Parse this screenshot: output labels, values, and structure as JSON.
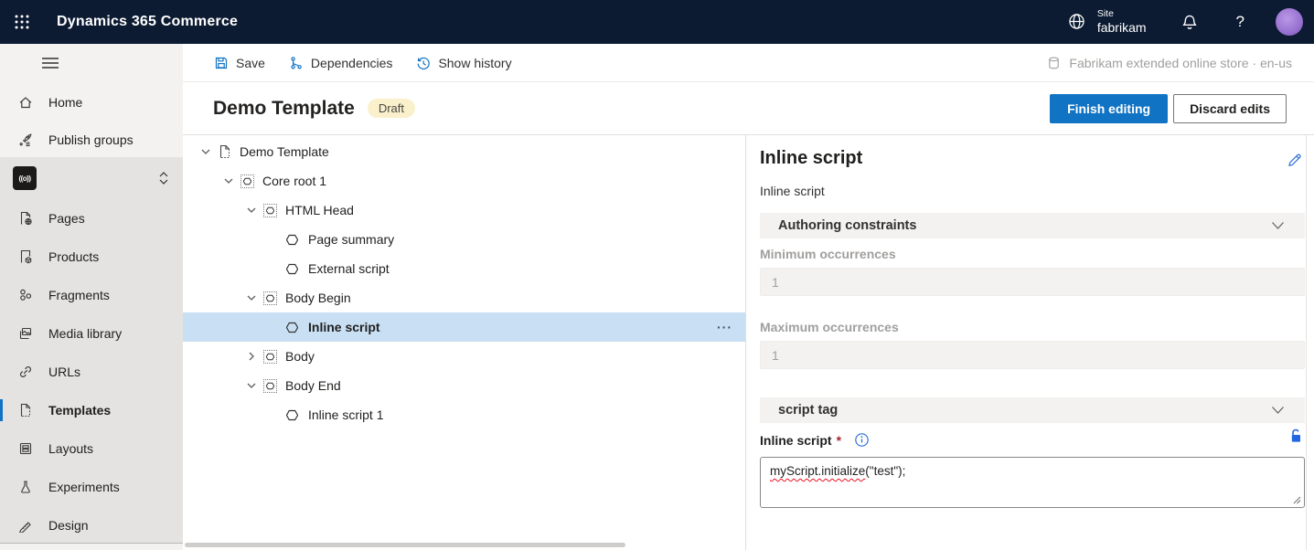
{
  "topbar": {
    "app_title": "Dynamics 365 Commerce",
    "site_label": "Site",
    "site_name": "fabrikam",
    "help_glyph": "?"
  },
  "toolbar": {
    "save_label": "Save",
    "dependencies_label": "Dependencies",
    "show_history_label": "Show history",
    "environment_label": "Fabrikam extended online store · en-us"
  },
  "sidebar": {
    "top_items": [
      {
        "label": "Home"
      },
      {
        "label": "Publish groups"
      }
    ],
    "broadcast_glyph": "((o))",
    "items": [
      {
        "label": "Pages"
      },
      {
        "label": "Products"
      },
      {
        "label": "Fragments"
      },
      {
        "label": "Media library"
      },
      {
        "label": "URLs"
      },
      {
        "label": "Templates",
        "selected": true
      },
      {
        "label": "Layouts"
      },
      {
        "label": "Experiments"
      },
      {
        "label": "Design"
      }
    ]
  },
  "header": {
    "title": "Demo Template",
    "status_badge": "Draft",
    "finish_button": "Finish editing",
    "discard_button": "Discard edits"
  },
  "tree": {
    "more_options_glyph": "···",
    "nodes": [
      {
        "label": "Demo Template",
        "level": 0,
        "chevron": "down",
        "icon": "page"
      },
      {
        "label": "Core root 1",
        "level": 1,
        "chevron": "down",
        "icon": "container"
      },
      {
        "label": "HTML Head",
        "level": 2,
        "chevron": "down",
        "icon": "container"
      },
      {
        "label": "Page summary",
        "level": 3,
        "chevron": null,
        "icon": "module"
      },
      {
        "label": "External script",
        "level": 3,
        "chevron": null,
        "icon": "module"
      },
      {
        "label": "Body Begin",
        "level": 2,
        "chevron": "down",
        "icon": "container"
      },
      {
        "label": "Inline script",
        "level": 3,
        "chevron": null,
        "icon": "module",
        "selected": true
      },
      {
        "label": "Body",
        "level": 2,
        "chevron": "right",
        "icon": "container"
      },
      {
        "label": "Body End",
        "level": 2,
        "chevron": "down",
        "icon": "container"
      },
      {
        "label": "Inline script 1",
        "level": 3,
        "chevron": null,
        "icon": "module"
      }
    ]
  },
  "panel": {
    "title": "Inline script",
    "subtitle": "Inline script",
    "authoring_section_label": "Authoring constraints",
    "min_label": "Minimum occurrences",
    "min_value": "1",
    "max_label": "Maximum occurrences",
    "max_value": "1",
    "script_section_label": "script tag",
    "field_label": "Inline script",
    "required_mark": "*",
    "script_value": "myScript.initialize(\"test\");",
    "script_value_misspelled_part": "myScript.initialize",
    "script_value_rest": "(\"test\");"
  },
  "colors": {
    "topbar_bg": "#0c1a32",
    "accent_blue": "#1173c4",
    "icon_blue": "#2b6fd4",
    "lock_blue": "#2266e3",
    "selected_row_bg": "#c9e0f4",
    "badge_bg": "#faf0cb",
    "sidebar_top_bg": "#f3f2f1",
    "sidebar_main_bg": "#e4e3e1",
    "divider": "#e1dfdd",
    "disabled_text": "#a19f9d",
    "error_red": "#e81123"
  }
}
